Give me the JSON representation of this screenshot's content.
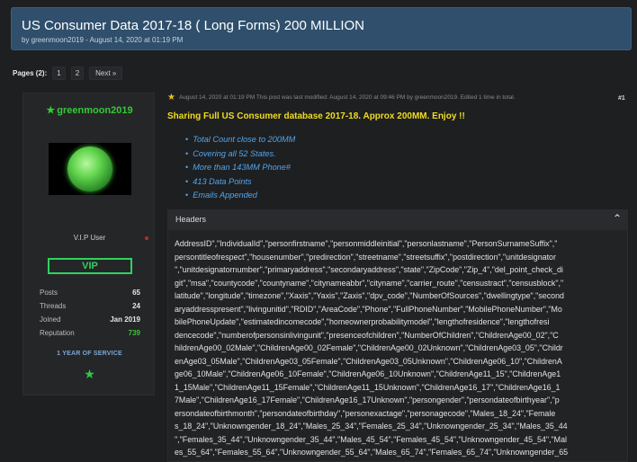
{
  "thread": {
    "title": "US Consumer Data 2017-18 ( Long Forms) 200 MILLION",
    "byline": "by greenmoon2019 - August 14, 2020 at 01:19 PM"
  },
  "pagination": {
    "label": "Pages (2):",
    "pages": [
      "1",
      "2"
    ],
    "next": "Next »"
  },
  "author": {
    "name": "greenmoon2019",
    "rank": "V.I.P User",
    "badge": "VIP",
    "stats": [
      {
        "label": "Posts",
        "value": "65"
      },
      {
        "label": "Threads",
        "value": "24"
      },
      {
        "label": "Joined",
        "value": "Jan 2019"
      },
      {
        "label": "Reputation",
        "value": "739"
      }
    ],
    "service": "1 YEAR OF SERVICE",
    "name_color": "#35c935",
    "vip_color": "#2fd35e"
  },
  "post": {
    "meta": "August 14, 2020 at 01:19 PM  This post was last modified: August 14, 2020 at 09:46 PM by greenmoon2019. Edited 1 time in total.",
    "number": "#1",
    "headline": "Sharing Full US Consumer database 2017-18. Approx 200MM. Enjoy !!",
    "bullets": [
      "Total Count close to 200MM",
      "Covering all 52 States.",
      "More than 143MM Phone#",
      "413 Data Points",
      "Emails Appended"
    ],
    "headline_color": "#f0dc21",
    "link_color": "#4fa6ee"
  },
  "spoiler": {
    "title": "Headers",
    "lines": [
      "AddressID\",\"IndividualId\",\"personfirstname\",\"personmiddleinitial\",\"personlastname\",\"PersonSurnameSuffix\",\"",
      "persontitleofrespect\",\"housenumber\",\"predirection\",\"streetname\",\"streetsuffix\",\"postdirection\",\"unitdesignator",
      "\",\"unitdesignatornumber\",\"primaryaddress\",\"secondaryaddress\",\"state\",\"ZipCode\",\"Zip_4\",\"del_point_check_di",
      "git\",\"msa\",\"countycode\",\"countyname\",\"citynameabbr\",\"cityname\",\"carrier_route\",\"censustract\",\"censusblock\",\"",
      "latitude\",\"longitude\",\"timezone\",\"Xaxis\",\"Yaxis\",\"Zaxis\",\"dpv_code\",\"NumberOfSources\",\"dwellingtype\",\"second",
      "aryaddresspresent\",\"livingunitid\",\"RDID\",\"AreaCode\",\"Phone\",\"FullPhoneNumber\",\"MobilePhoneNumber\",\"Mo",
      "bilePhoneUpdate\",\"estimatedincomecode\",\"homeownerprobabilitymodel\",\"lengthofresidence\",\"lengthofresi",
      "dencecode\",\"numberofpersonsinlivingunit\",\"presenceofchildren\",\"NumberOfChildren\",\"ChildrenAge00_02\",\"C",
      "hildrenAge00_02Male\",\"ChildrenAge00_02Female\",\"ChildrenAge00_02Unknown\",\"ChildrenAge03_05\",\"Childr",
      "enAge03_05Male\",\"ChildrenAge03_05Female\",\"ChildrenAge03_05Unknown\",\"ChildrenAge06_10\",\"ChildrenA",
      "ge06_10Male\",\"ChildrenAge06_10Female\",\"ChildrenAge06_10Unknown\",\"ChildrenAge11_15\",\"ChildrenAge1",
      "1_15Male\",\"ChildrenAge11_15Female\",\"ChildrenAge11_15Unknown\",\"ChildrenAge16_17\",\"ChildrenAge16_1",
      "7Male\",\"ChildrenAge16_17Female\",\"ChildrenAge16_17Unknown\",\"persongender\",\"persondateofbirthyear\",\"p",
      "ersondateofbirthmonth\",\"persondateofbirthday\",\"personexactage\",\"personagecode\",\"Males_18_24\",\"Female",
      "s_18_24\",\"Unknowngender_18_24\",\"Males_25_34\",\"Females_25_34\",\"Unknowngender_25_34\",\"Males_35_44",
      "\",\"Females_35_44\",\"Unknowngender_35_44\",\"Males_45_54\",\"Females_45_54\",\"Unknowngender_45_54\",\"Mal",
      "es_55_64\",\"Females_55_64\",\"Unknowngender_55_64\",\"Males_65_74\",\"Females_65_74\",\"Unknowngender_65"
    ]
  }
}
